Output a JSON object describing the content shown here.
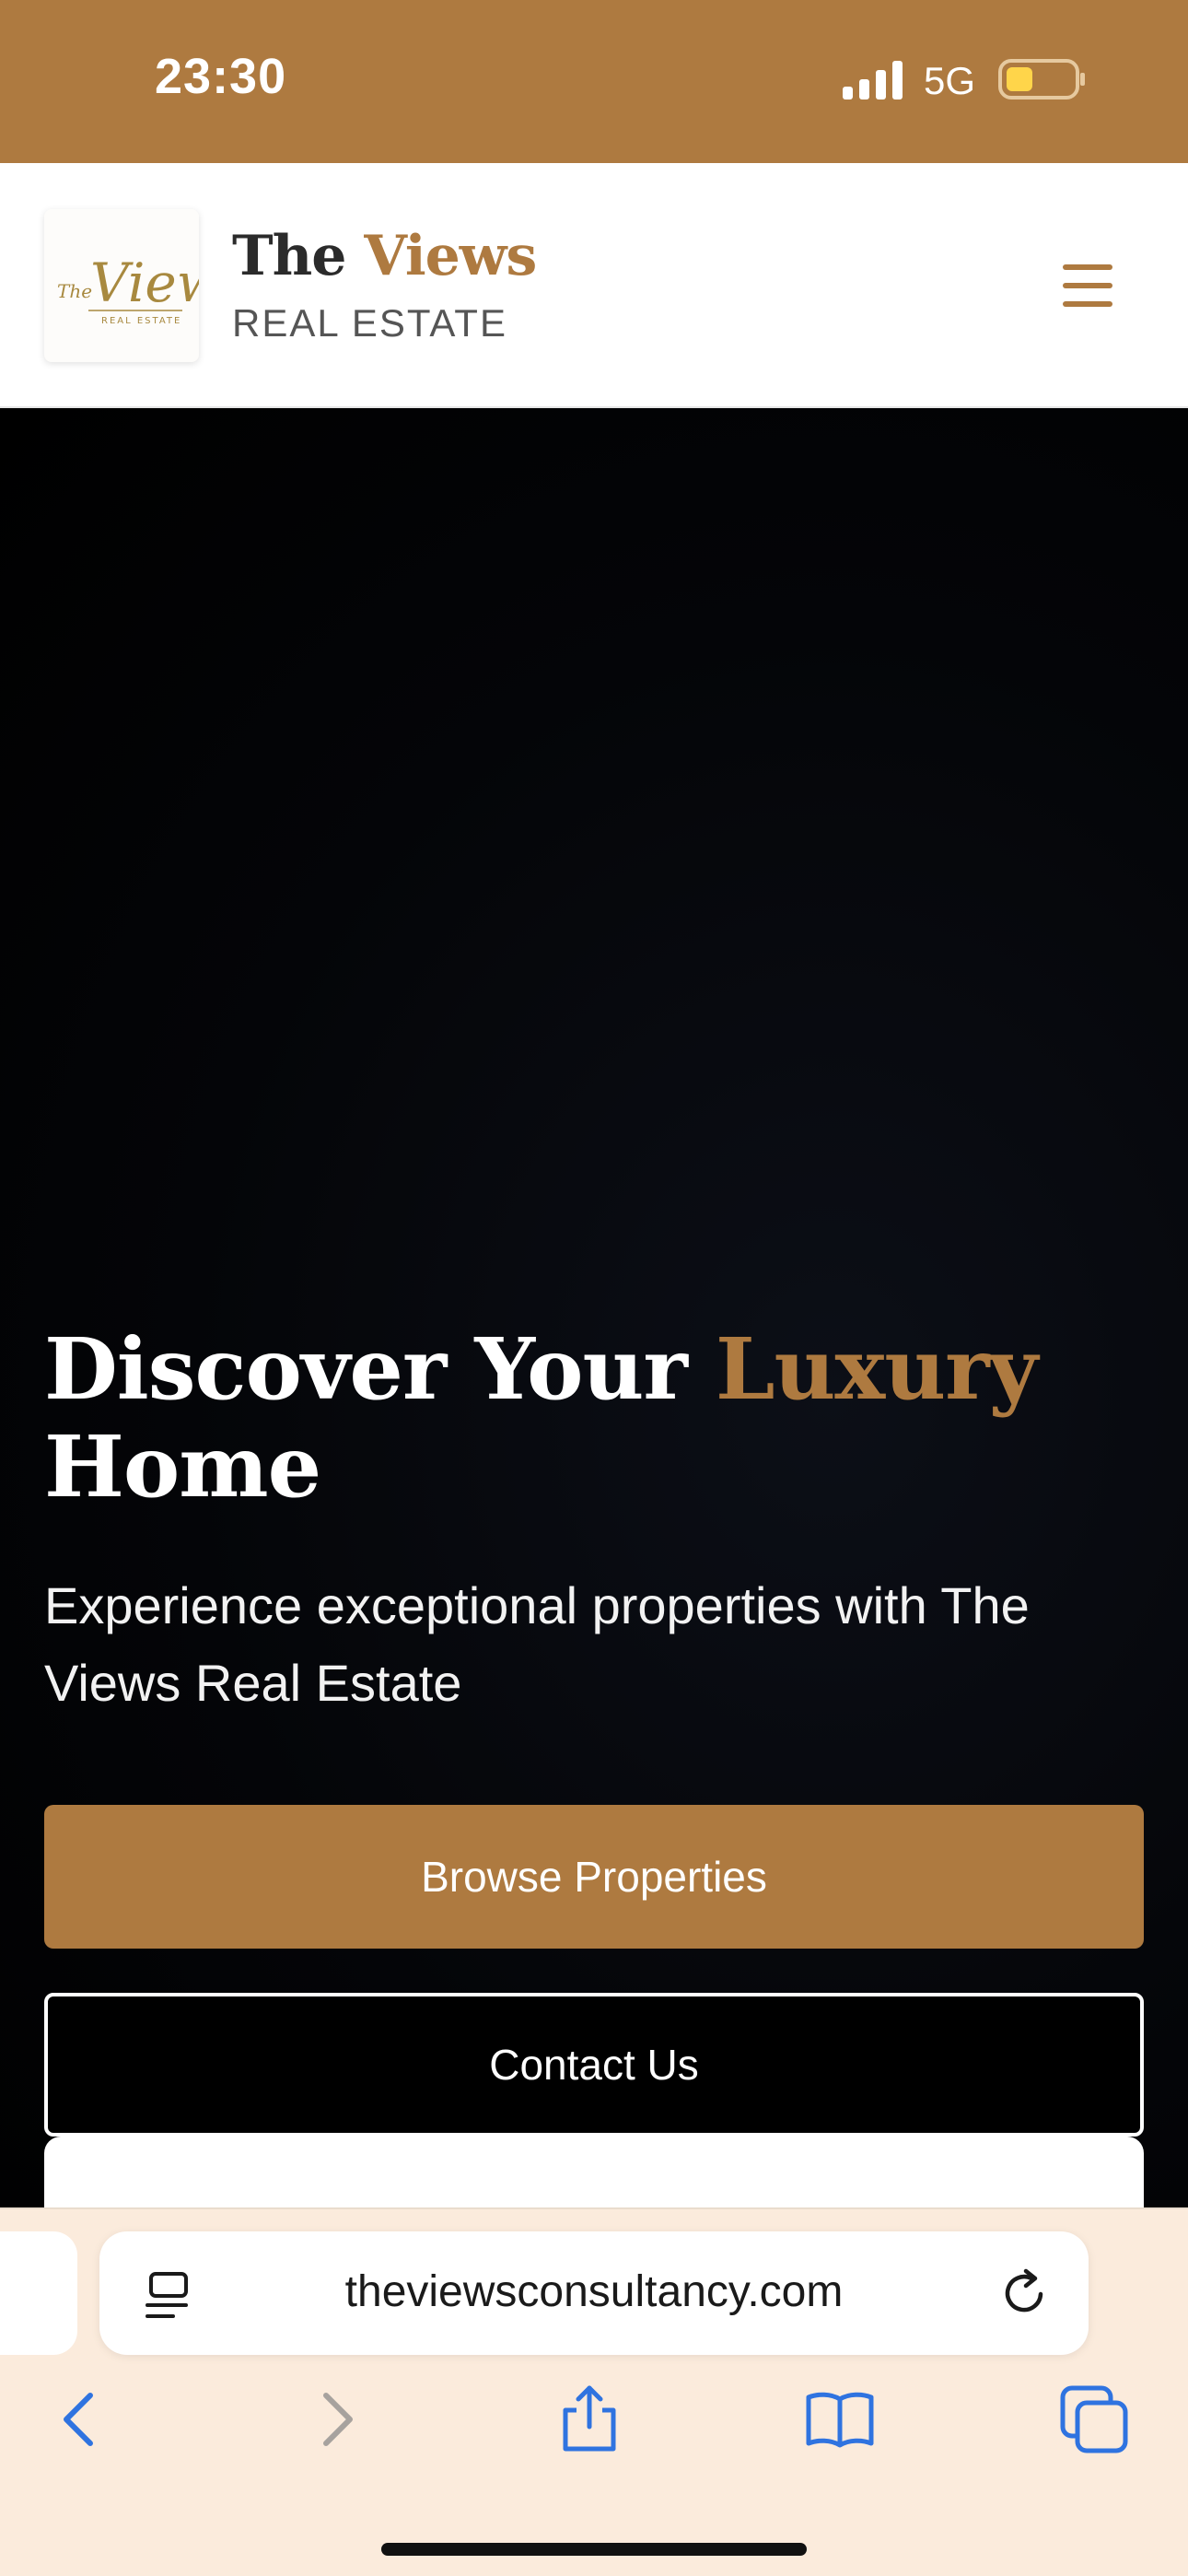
{
  "status_bar": {
    "time": "23:30",
    "network": "5G",
    "icons": [
      "signal-icon",
      "battery-icon"
    ]
  },
  "header": {
    "logo_alt": "The Views Real Estate",
    "brand_the": "The",
    "brand_views": "Views",
    "brand_sub": "REAL ESTATE",
    "menu_icon": "hamburger-menu-icon"
  },
  "hero": {
    "title_part1": "Discover Your ",
    "title_accent": "Luxury",
    "title_part2": "Home",
    "subtitle": "Experience exceptional properties with The Views Real Estate",
    "browse_label": "Browse Properties",
    "contact_label": "Contact Us"
  },
  "browser": {
    "url": "theviewsconsultancy.com",
    "icons": [
      "reader-icon",
      "reload-icon",
      "back-icon",
      "forward-icon",
      "share-icon",
      "bookmarks-icon",
      "tabs-icon"
    ]
  },
  "colors": {
    "accent": "#ae7a40",
    "status_bar": "#ae7a40",
    "toolbar_bg": "#fbebdc",
    "ios_blue": "#2f73e0",
    "disabled": "#a7a29e"
  }
}
